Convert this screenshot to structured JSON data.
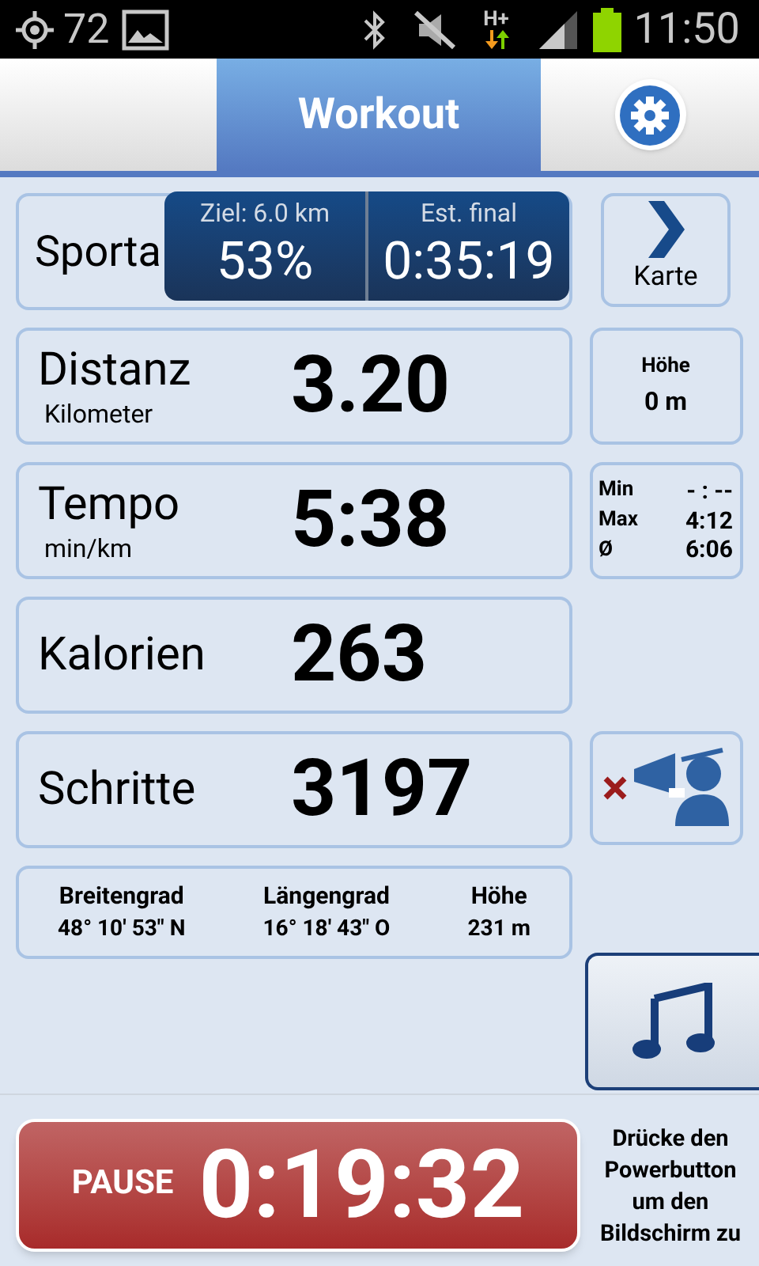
{
  "status_bar": {
    "number": "72",
    "network": "H+",
    "time": "11:50"
  },
  "header": {
    "tab": {
      "label": "Workout",
      "selected": true
    }
  },
  "sport": {
    "label": "Sporta"
  },
  "goal": {
    "target": "Ziel: 6.0 km",
    "percent": "53%",
    "est_label": "Est. final",
    "est_value": "0:35:19"
  },
  "map_button": {
    "label": "Karte"
  },
  "metrics": [
    {
      "label": "Distanz",
      "unit": "Kilometer",
      "value": "3.20"
    },
    {
      "label": "Tempo",
      "unit": "min/km",
      "value": "5:38"
    },
    {
      "label": "Kalorien",
      "value": "263"
    },
    {
      "label": "Schritte",
      "value": "3197"
    }
  ],
  "altitude": {
    "label": "Höhe",
    "value": "0 m"
  },
  "pace_stats": [
    {
      "label": "Min",
      "value": "- : --"
    },
    {
      "label": "Max",
      "value": "4:12"
    },
    {
      "label": "Ø",
      "value": "6:06"
    }
  ],
  "voice": {
    "muted": true
  },
  "location": [
    {
      "label": "Breitengrad",
      "value": "48° 10' 53\" N"
    },
    {
      "label": "Längengrad",
      "value": "16° 18' 43\" O"
    },
    {
      "label": "Höhe",
      "value": "231 m"
    }
  ],
  "timer": {
    "button": "PAUSE",
    "time": "0:19:32"
  },
  "lock_hint": "Drücke den Powerbutton um den Bildschirm zu"
}
